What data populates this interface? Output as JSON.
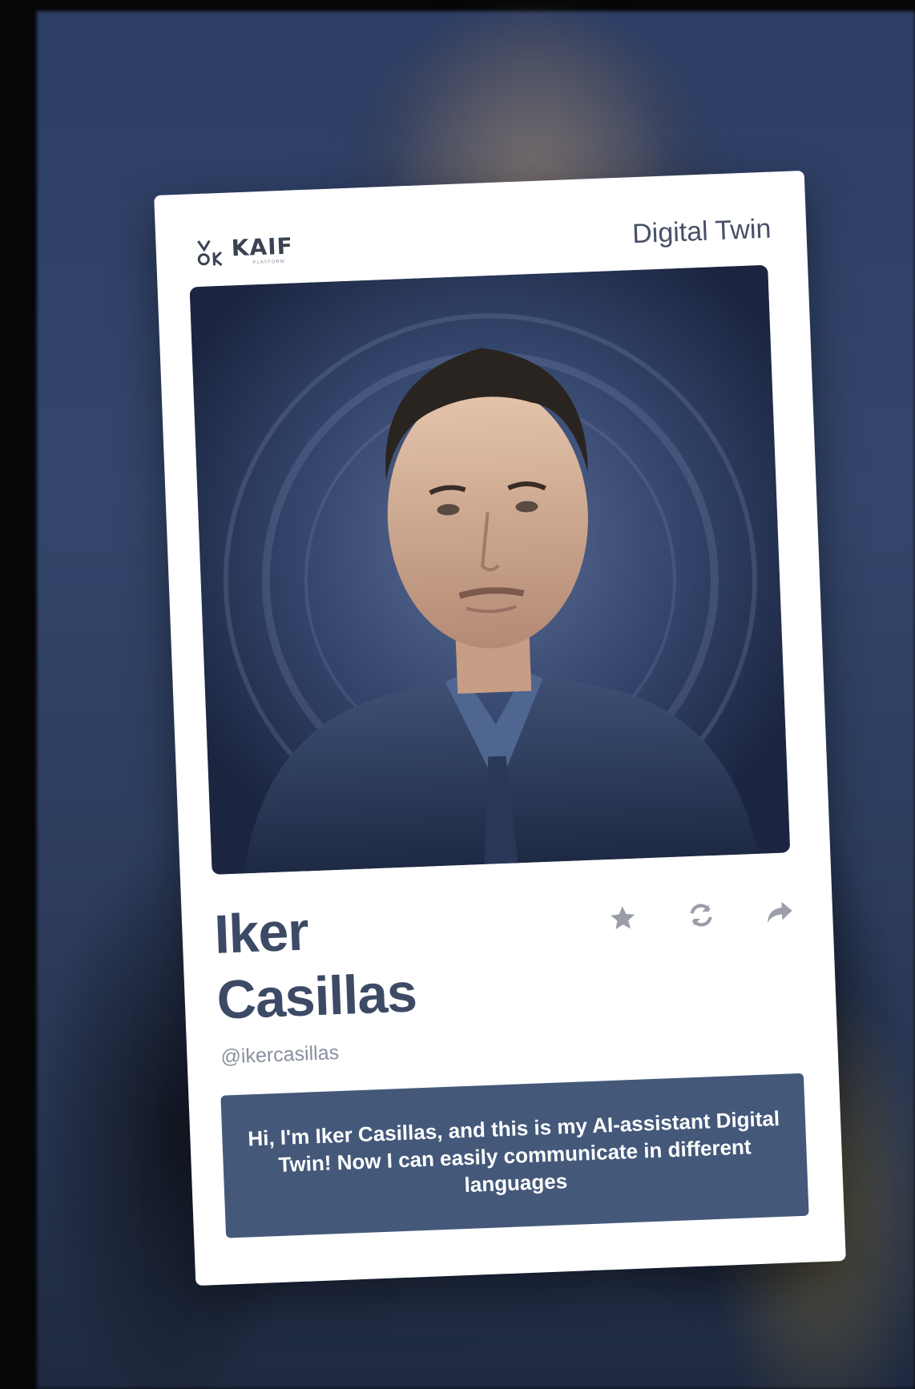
{
  "card": {
    "brand": {
      "name": "KAIF",
      "tagline": "PLATFORM"
    },
    "top_label": "Digital Twin",
    "profile": {
      "first_name": "Iker",
      "last_name": "Casillas",
      "handle": "@ikercasillas"
    },
    "actions": [
      {
        "name": "favorite",
        "icon": "star-icon"
      },
      {
        "name": "refresh",
        "icon": "refresh-icon"
      },
      {
        "name": "share",
        "icon": "share-icon"
      }
    ],
    "message": "Hi, I'm Iker Casillas, and this is my AI-assistant Digital Twin! Now I can easily communicate in different languages"
  },
  "colors": {
    "accent": "#44587a",
    "title": "#3d4a66",
    "muted": "#8a90a0",
    "card_bg": "#ffffff",
    "background": "#2e3f66"
  }
}
